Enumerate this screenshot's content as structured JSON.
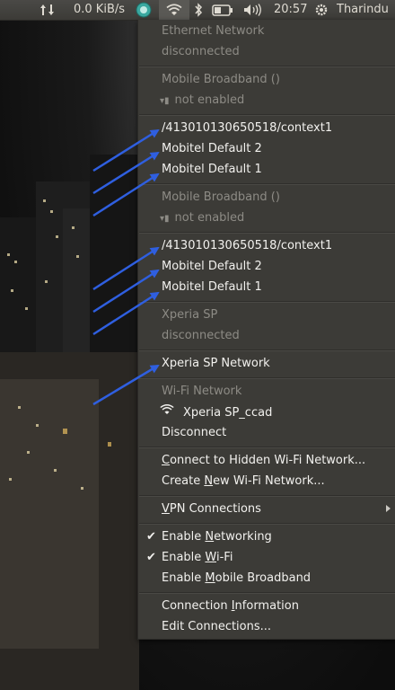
{
  "panel": {
    "network_speed": "0.0 KiB/s",
    "time": "20:57",
    "user": "Tharindu",
    "icons": [
      "updown-arrows-icon",
      "network-monitor-icon",
      "wifi-icon",
      "bluetooth-icon",
      "battery-icon",
      "volume-icon",
      "power-gear-icon"
    ]
  },
  "menu": {
    "ethernet_header": "Ethernet Network",
    "ethernet_status": "disconnected",
    "mobile1_header": "Mobile Broadband ()",
    "mobile1_status": "not enabled",
    "group1": [
      "/413010130650518/context1",
      "Mobitel Default 2",
      "Mobitel Default 1"
    ],
    "mobile2_header": "Mobile Broadband ()",
    "mobile2_status": "not enabled",
    "group2": [
      "/413010130650518/context1",
      "Mobitel Default 2",
      "Mobitel Default 1"
    ],
    "xperia_header": "Xperia SP",
    "xperia_status": "disconnected",
    "xperia_network": "Xperia SP Network",
    "wifi_header": "Wi-Fi Network",
    "wifi_ssid": "Xperia SP_ccad",
    "disconnect": "Disconnect",
    "connect_hidden_pre": "",
    "connect_hidden_u": "C",
    "connect_hidden_post": "onnect to Hidden Wi-Fi Network...",
    "create_new_pre": "Create ",
    "create_new_u": "N",
    "create_new_post": "ew Wi-Fi Network...",
    "vpn_u": "V",
    "vpn_post": "PN Connections",
    "enable_networking_pre": "Enable ",
    "enable_networking_u": "N",
    "enable_networking_post": "etworking",
    "enable_networking_checked": true,
    "enable_wifi_pre": "Enable ",
    "enable_wifi_u": "W",
    "enable_wifi_post": "i-Fi",
    "enable_wifi_checked": true,
    "enable_mobile_pre": "Enable ",
    "enable_mobile_u": "M",
    "enable_mobile_post": "obile Broadband",
    "conn_info_pre": "Connection ",
    "conn_info_u": "I",
    "conn_info_post": "nformation",
    "edit_connections": "Edit Connections..."
  },
  "annotation_color": "#2f5fe0"
}
